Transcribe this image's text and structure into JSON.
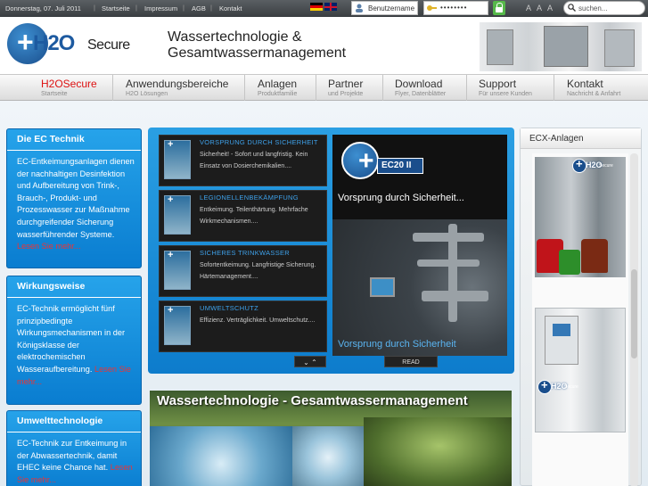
{
  "topbar": {
    "date": "Donnerstag, 07. Juli 2011",
    "links": [
      "Startseite",
      "Impressum",
      "AGB",
      "Kontakt"
    ],
    "username_placeholder": "Benutzername",
    "password_mask": "••••••••",
    "font_sizes": [
      "A",
      "A",
      "A"
    ],
    "search_placeholder": "suchen..."
  },
  "header": {
    "logo_plus": "+",
    "logo_h2o": "H2O",
    "logo_secure": "Secure",
    "slogan_line1": "Wassertechnologie &",
    "slogan_line2": "Gesamtwassermanagement"
  },
  "nav": [
    {
      "title": "H2OSecure",
      "subtitle": "Startseite"
    },
    {
      "title": "Anwendungsbereiche",
      "subtitle": "H2O Lösungen"
    },
    {
      "title": "Anlagen",
      "subtitle": "Produktfamilie"
    },
    {
      "title": "Partner",
      "subtitle": "und Projekte"
    },
    {
      "title": "Download",
      "subtitle": "Flyer, Datenblätter"
    },
    {
      "title": "Support",
      "subtitle": "Für unsere Kunden"
    },
    {
      "title": "Kontakt",
      "subtitle": "Nachricht & Anfahrt"
    }
  ],
  "left_boxes": [
    {
      "title": "Die EC Technik",
      "text": "EC-Entkeimungsanlagen dienen der nachhaltigen Desinfektion und Aufbereitung von Trink-, Brauch-, Produkt- und Prozesswasser zur Maßnahme durchgreifender Sicherung wasserführender Systeme.",
      "more": "Lesen Sie mehr..."
    },
    {
      "title": "Wirkungsweise",
      "text": "EC-Technik ermöglicht fünf prinzipbedingte Wirkungsmechanismen in der Königsklasse der elektrochemischen Wasseraufbereitung.",
      "more": "Lesen Sie mehr..."
    },
    {
      "title": "Umwelttechnologie",
      "text": "EC-Technik zur Entkeimung in der Abwassertechnik, damit EHEC keine Chance hat.",
      "more": "Lesen Sie mehr..."
    }
  ],
  "slider": {
    "items": [
      {
        "title": "VORSPRUNG DURCH SICHERHEIT",
        "desc": "Sicherheit! - Sofort und langfristig. Kein Einsatz von Dosierchemikalien...."
      },
      {
        "title": "LEGIONELLENBEKÄMPFUNG",
        "desc": "Entkeimung. Teilenthärtung. Mehrfache Wirkmechanismen...."
      },
      {
        "title": "SICHERES TRINKWASSER",
        "desc": "Sofortentkeimung. Langfristige Sicherung. Härtemanagement...."
      },
      {
        "title": "UMWELTSCHUTZ",
        "desc": "Effizienz. Verträglichkeit. Umweltschutz...."
      }
    ],
    "main_badge": "EC20 II",
    "main_caption_top": "Vorsprung durch Sicherheit...",
    "main_caption_bottom": "Vorsprung durch Sicherheit",
    "arrows": "⌄ ⌃",
    "read_label": "READ"
  },
  "banner": {
    "title": "Wassertechnologie - Gesamtwassermanagement"
  },
  "right_panel": {
    "title": "ECX-Anlagen",
    "badge_h2o": "H2O",
    "badge_secure": "Secure"
  }
}
